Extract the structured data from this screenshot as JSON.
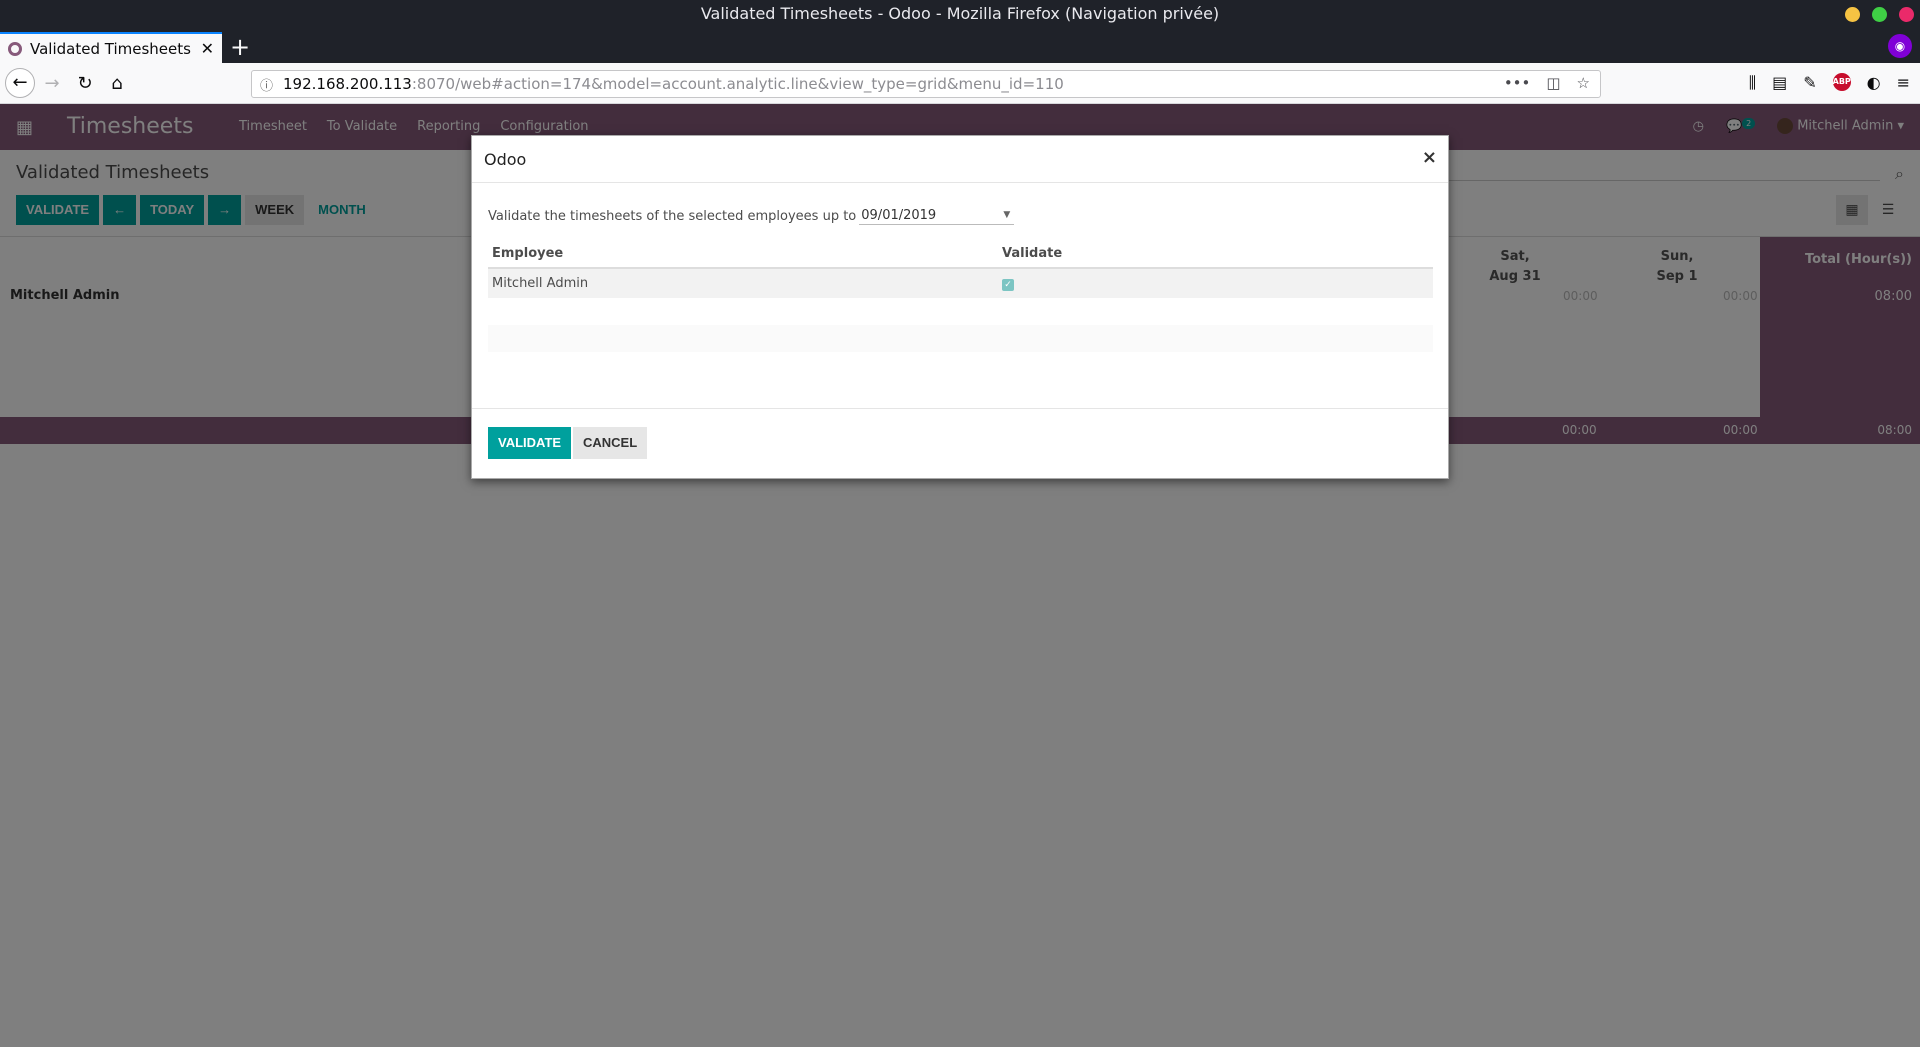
{
  "window": {
    "title": "Validated Timesheets - Odoo - Mozilla Firefox (Navigation privée)"
  },
  "tab": {
    "title": "Validated Timesheets - O"
  },
  "url": {
    "host": "192.168.200.113",
    "rest": ":8070/web#action=174&model=account.analytic.line&view_type=grid&menu_id=110"
  },
  "app": {
    "brand": "Timesheets",
    "menus": [
      "Timesheet",
      "To Validate",
      "Reporting",
      "Configuration"
    ],
    "message_count": "2",
    "user": "Mitchell Admin"
  },
  "control_panel": {
    "breadcrumb": "Validated Timesheets",
    "validate_label": "VALIDATE",
    "today_label": "TODAY",
    "week_label": "WEEK",
    "month_label": "MONTH"
  },
  "grid": {
    "columns": [
      {
        "day": "Sat,",
        "date": "Aug 31"
      },
      {
        "day": "Sun,",
        "date": "Sep 1"
      }
    ],
    "total_header": "Total (Hour(s))",
    "employee": "Mitchell Admin",
    "cells": [
      "00:00",
      "00:00"
    ],
    "row_total": "08:00",
    "footer": [
      "00:00",
      "00:00",
      "08:00"
    ]
  },
  "modal": {
    "title": "Odoo",
    "prompt": "Validate the timesheets of the selected employees up to",
    "date": "09/01/2019",
    "col_employee": "Employee",
    "col_validate": "Validate",
    "rows": [
      {
        "employee": "Mitchell Admin",
        "validate": true
      }
    ],
    "validate_label": "VALIDATE",
    "cancel_label": "CANCEL"
  },
  "colors": {
    "odoo_primary": "#875a7b",
    "accent": "#00a09d"
  }
}
